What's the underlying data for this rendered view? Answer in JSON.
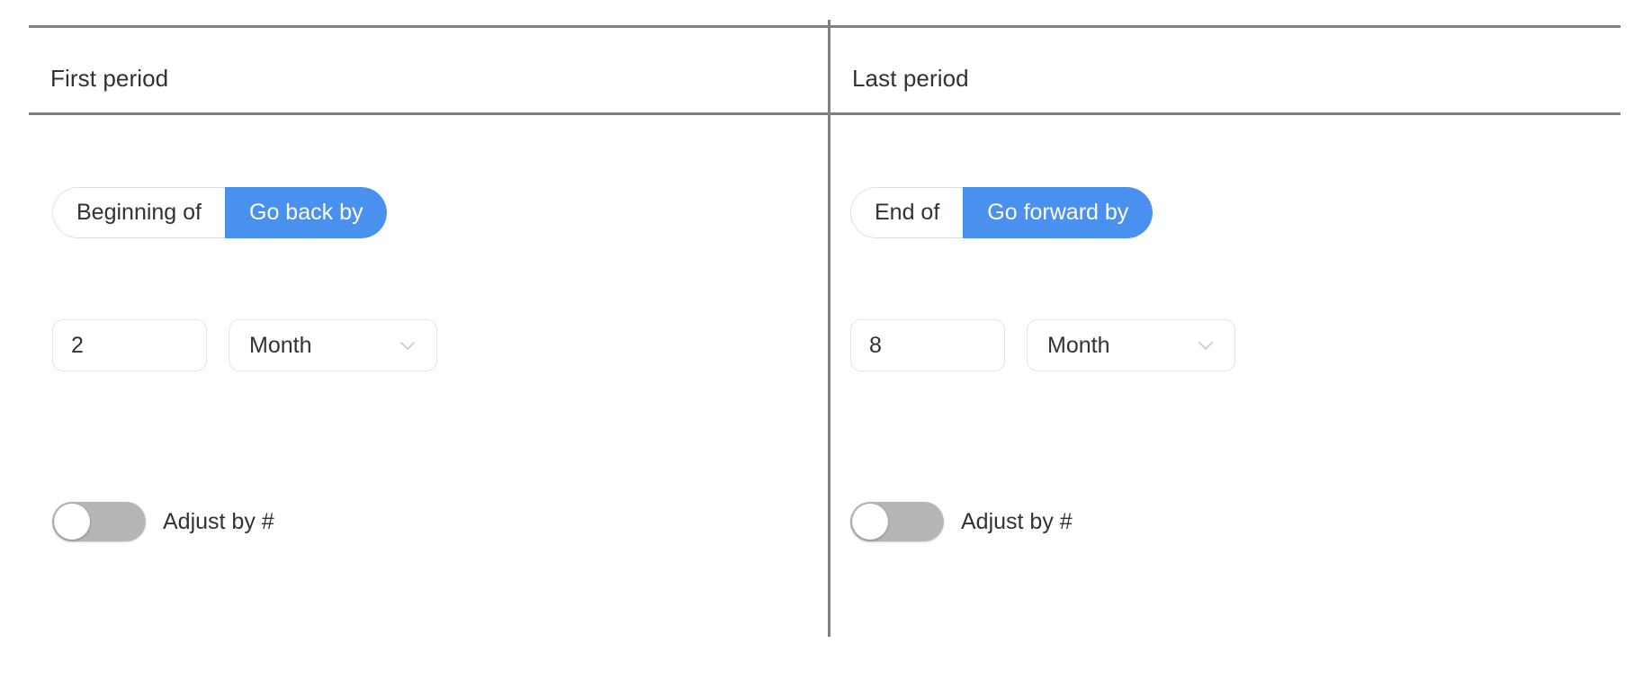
{
  "theme": {
    "accent": "#4a90ee",
    "rule_color": "#808080",
    "text_color": "#2e3338",
    "switch_track_off": "#b6b6b6",
    "border_color": "#e2e5e8",
    "background": "#ffffff"
  },
  "panels": [
    {
      "id": "first-period",
      "header": "First period",
      "segmented": {
        "options": [
          "Beginning of",
          "Go back by"
        ],
        "inactive_label": "Beginning of",
        "active_label": "Go back by",
        "selected_index": 1
      },
      "amount": {
        "value": "2",
        "placeholder": "0"
      },
      "unit": {
        "selected": "Month",
        "icon": "chevron-down-icon"
      },
      "toggle": {
        "label": "Adjust by #",
        "checked": false
      }
    },
    {
      "id": "last-period",
      "header": "Last period",
      "segmented": {
        "options": [
          "End of",
          "Go forward by"
        ],
        "inactive_label": "End of",
        "active_label": "Go forward by",
        "selected_index": 1
      },
      "amount": {
        "value": "8",
        "placeholder": "0"
      },
      "unit": {
        "selected": "Month",
        "icon": "chevron-down-icon"
      },
      "toggle": {
        "label": "Adjust by #",
        "checked": false
      }
    }
  ]
}
